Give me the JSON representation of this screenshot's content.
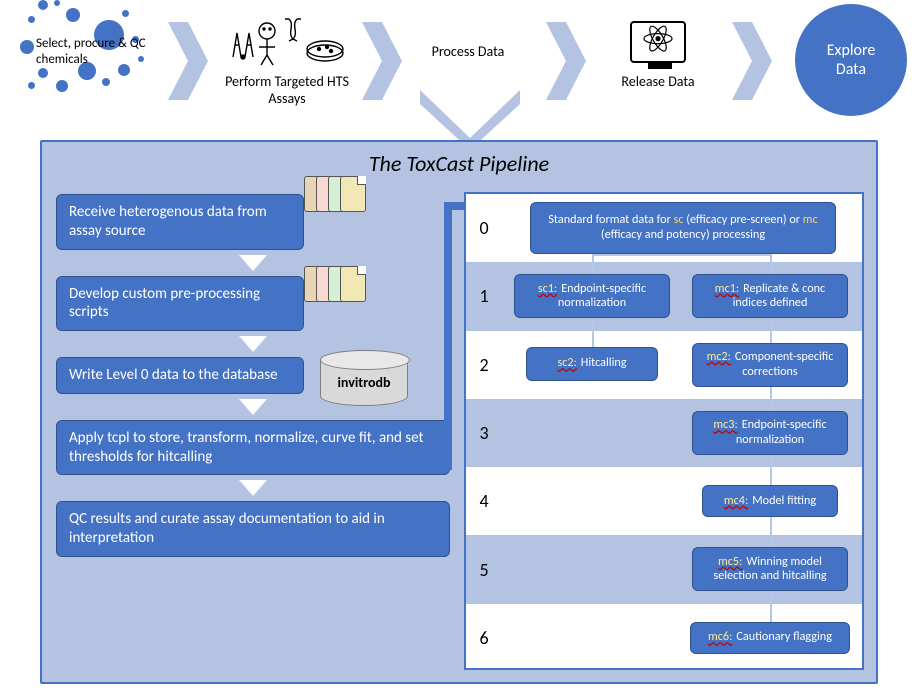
{
  "top_stages": {
    "s1": "Select, procure & QC chemicals",
    "s2": "Perform Targeted HTS Assays",
    "s3": "Process Data",
    "s4": "Release Data",
    "s5a": "Explore",
    "s5b": "Data"
  },
  "panel": {
    "title": "The ToxCast Pipeline",
    "left_steps": {
      "step1": "Receive heterogenous data from assay source",
      "step2": "Develop custom pre-processing scripts",
      "step3": "Write Level 0 data to the database",
      "step4": "Apply tcpl to store, transform, normalize, curve fit, and set thresholds for hitcalling",
      "step5": "QC results and curate assay documentation to aid in interpretation"
    },
    "db_label": "invitrodb"
  },
  "levels": {
    "nums": [
      "0",
      "1",
      "2",
      "3",
      "4",
      "5",
      "6"
    ],
    "l0_a": "Standard format data for ",
    "l0_sc": "sc",
    "l0_b": " (efficacy pre-screen) or ",
    "l0_mc": "mc",
    "l0_c": " (efficacy and potency) processing",
    "sc1_pre": "sc1:",
    "sc1": "Endpoint-specific normalization",
    "sc2_pre": "sc2:",
    "sc2": "Hitcalling",
    "mc1_pre": "mc1:",
    "mc1": "Replicate & conc indices defined",
    "mc2_pre": "mc2:",
    "mc2": "Component-specific corrections",
    "mc3_pre": "mc3:",
    "mc3": "Endpoint-specific normalization",
    "mc4_pre": "mc4:",
    "mc4": "Model fitting",
    "mc5_pre": "mc5:",
    "mc5": "Winning model selection and hitcalling",
    "mc6_pre": "mc6:",
    "mc6": "Cautionary flagging"
  }
}
